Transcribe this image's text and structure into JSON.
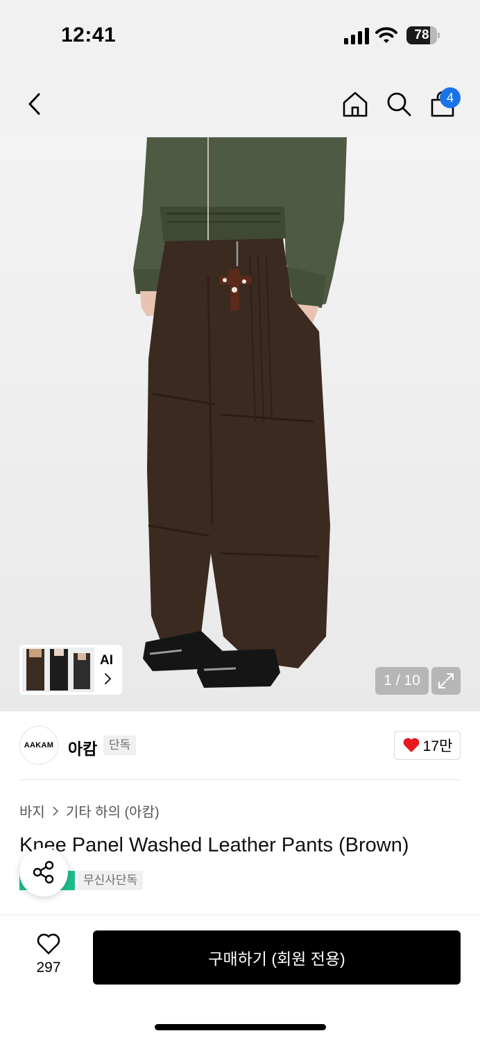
{
  "status_bar": {
    "time": "12:41",
    "battery_level": "78",
    "battery_fraction": 0.78
  },
  "nav": {
    "cart_badge": "4",
    "icons": [
      "back-chevron-icon",
      "home-icon",
      "search-icon",
      "shopping-bag-icon"
    ]
  },
  "gallery": {
    "ai_label": "AI",
    "counter": "1 / 10",
    "current_page": 1,
    "total_pages": 10
  },
  "brand": {
    "logo_text": "AAKAM",
    "name": "아캄",
    "exclusive_tag": "단독",
    "likes": "17만"
  },
  "product": {
    "breadcrumb": [
      "바지",
      "기타 하의 (아캄)"
    ],
    "title": "Knee Panel Washed Leather Pants (Brown)",
    "tags": [
      "무신사단독"
    ]
  },
  "bottom_bar": {
    "wishlist_count": "297",
    "buy_label": "구매하기 (회원 전용)"
  },
  "colors": {
    "accent_blue": "#1a73e8",
    "heart_red": "#e5191e",
    "tag_green": "#1dbd8b",
    "buy_button": "#000000"
  }
}
